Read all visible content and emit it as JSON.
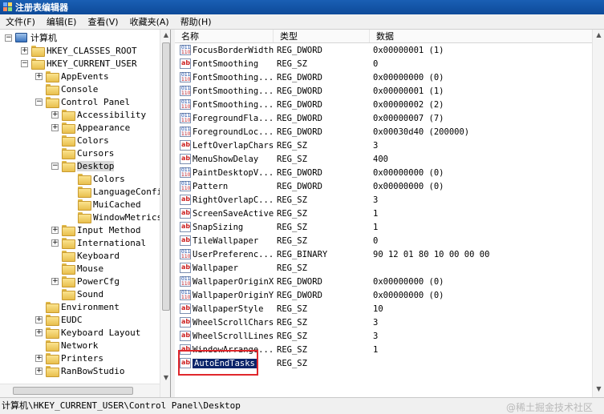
{
  "window": {
    "title": "注册表编辑器"
  },
  "menu": [
    "文件(F)",
    "编辑(E)",
    "查看(V)",
    "收藏夹(A)",
    "帮助(H)"
  ],
  "tree": [
    {
      "label": "计算机",
      "level": 0,
      "expander": "minus",
      "icon": "computer-icon"
    },
    {
      "label": "HKEY_CLASSES_ROOT",
      "level": 1,
      "expander": "plus",
      "icon": "folder-icon"
    },
    {
      "label": "HKEY_CURRENT_USER",
      "level": 1,
      "expander": "minus",
      "icon": "folder-icon"
    },
    {
      "label": "AppEvents",
      "level": 2,
      "expander": "plus",
      "icon": "folder-icon"
    },
    {
      "label": "Console",
      "level": 2,
      "expander": "none",
      "icon": "folder-icon"
    },
    {
      "label": "Control Panel",
      "level": 2,
      "expander": "minus",
      "icon": "folder-icon"
    },
    {
      "label": "Accessibility",
      "level": 3,
      "expander": "plus",
      "icon": "folder-icon"
    },
    {
      "label": "Appearance",
      "level": 3,
      "expander": "plus",
      "icon": "folder-icon"
    },
    {
      "label": "Colors",
      "level": 3,
      "expander": "none",
      "icon": "folder-icon"
    },
    {
      "label": "Cursors",
      "level": 3,
      "expander": "none",
      "icon": "folder-icon"
    },
    {
      "label": "Desktop",
      "level": 3,
      "expander": "minus",
      "icon": "folder-icon",
      "selected": true
    },
    {
      "label": "Colors",
      "level": 4,
      "expander": "none",
      "icon": "folder-icon"
    },
    {
      "label": "LanguageConfi",
      "level": 4,
      "expander": "none",
      "icon": "folder-icon"
    },
    {
      "label": "MuiCached",
      "level": 4,
      "expander": "none",
      "icon": "folder-icon"
    },
    {
      "label": "WindowMetrics",
      "level": 4,
      "expander": "none",
      "icon": "folder-icon"
    },
    {
      "label": "Input Method",
      "level": 3,
      "expander": "plus",
      "icon": "folder-icon"
    },
    {
      "label": "International",
      "level": 3,
      "expander": "plus",
      "icon": "folder-icon"
    },
    {
      "label": "Keyboard",
      "level": 3,
      "expander": "none",
      "icon": "folder-icon"
    },
    {
      "label": "Mouse",
      "level": 3,
      "expander": "none",
      "icon": "folder-icon"
    },
    {
      "label": "PowerCfg",
      "level": 3,
      "expander": "plus",
      "icon": "folder-icon"
    },
    {
      "label": "Sound",
      "level": 3,
      "expander": "none",
      "icon": "folder-icon"
    },
    {
      "label": "Environment",
      "level": 2,
      "expander": "none",
      "icon": "folder-icon"
    },
    {
      "label": "EUDC",
      "level": 2,
      "expander": "plus",
      "icon": "folder-icon"
    },
    {
      "label": "Keyboard Layout",
      "level": 2,
      "expander": "plus",
      "icon": "folder-icon"
    },
    {
      "label": "Network",
      "level": 2,
      "expander": "none",
      "icon": "folder-icon"
    },
    {
      "label": "Printers",
      "level": 2,
      "expander": "plus",
      "icon": "folder-icon"
    },
    {
      "label": "RanBowStudio",
      "level": 2,
      "expander": "plus",
      "icon": "folder-icon"
    }
  ],
  "columns": {
    "name": "名称",
    "type": "类型",
    "data": "数据"
  },
  "values": [
    {
      "name": "FocusBorderWidth",
      "type": "REG_DWORD",
      "data": "0x00000001 (1)",
      "icon": "dword"
    },
    {
      "name": "FontSmoothing",
      "type": "REG_SZ",
      "data": "0",
      "icon": "sz"
    },
    {
      "name": "FontSmoothing...",
      "type": "REG_DWORD",
      "data": "0x00000000 (0)",
      "icon": "dword"
    },
    {
      "name": "FontSmoothing...",
      "type": "REG_DWORD",
      "data": "0x00000001 (1)",
      "icon": "dword"
    },
    {
      "name": "FontSmoothing...",
      "type": "REG_DWORD",
      "data": "0x00000002 (2)",
      "icon": "dword"
    },
    {
      "name": "ForegroundFla...",
      "type": "REG_DWORD",
      "data": "0x00000007 (7)",
      "icon": "dword"
    },
    {
      "name": "ForegroundLoc...",
      "type": "REG_DWORD",
      "data": "0x00030d40 (200000)",
      "icon": "dword"
    },
    {
      "name": "LeftOverlapChars",
      "type": "REG_SZ",
      "data": "3",
      "icon": "sz"
    },
    {
      "name": "MenuShowDelay",
      "type": "REG_SZ",
      "data": "400",
      "icon": "sz"
    },
    {
      "name": "PaintDesktopV...",
      "type": "REG_DWORD",
      "data": "0x00000000 (0)",
      "icon": "dword"
    },
    {
      "name": "Pattern",
      "type": "REG_DWORD",
      "data": "0x00000000 (0)",
      "icon": "dword"
    },
    {
      "name": "RightOverlapC...",
      "type": "REG_SZ",
      "data": "3",
      "icon": "sz"
    },
    {
      "name": "ScreenSaveActive",
      "type": "REG_SZ",
      "data": "1",
      "icon": "sz"
    },
    {
      "name": "SnapSizing",
      "type": "REG_SZ",
      "data": "1",
      "icon": "sz"
    },
    {
      "name": "TileWallpaper",
      "type": "REG_SZ",
      "data": "0",
      "icon": "sz"
    },
    {
      "name": "UserPreferenc...",
      "type": "REG_BINARY",
      "data": "90 12 01 80 10 00 00 00",
      "icon": "dword"
    },
    {
      "name": "Wallpaper",
      "type": "REG_SZ",
      "data": "",
      "icon": "sz"
    },
    {
      "name": "WallpaperOriginX",
      "type": "REG_DWORD",
      "data": "0x00000000 (0)",
      "icon": "dword"
    },
    {
      "name": "WallpaperOriginY",
      "type": "REG_DWORD",
      "data": "0x00000000 (0)",
      "icon": "dword"
    },
    {
      "name": "WallpaperStyle",
      "type": "REG_SZ",
      "data": "10",
      "icon": "sz"
    },
    {
      "name": "WheelScrollChars",
      "type": "REG_SZ",
      "data": "3",
      "icon": "sz"
    },
    {
      "name": "WheelScrollLines",
      "type": "REG_SZ",
      "data": "3",
      "icon": "sz"
    },
    {
      "name": "WindowArrange...",
      "type": "REG_SZ",
      "data": "1",
      "icon": "sz"
    },
    {
      "name": "AutoEndTasks",
      "type": "REG_SZ",
      "data": "",
      "icon": "sz",
      "selected": true
    }
  ],
  "status": {
    "path": "计算机\\HKEY_CURRENT_USER\\Control Panel\\Desktop",
    "watermark": "@稀土掘金技术社区"
  }
}
